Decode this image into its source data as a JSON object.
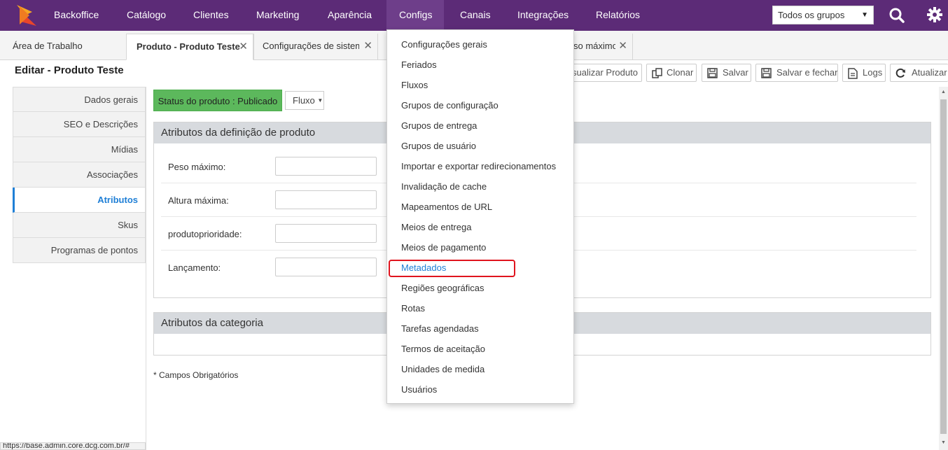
{
  "topnav": {
    "brand": "Backoffice",
    "items": [
      "Catálogo",
      "Clientes",
      "Marketing",
      "Aparência",
      "Configs",
      "Canais",
      "Integrações",
      "Relatórios"
    ],
    "group_select": "Todos os grupos",
    "icons": [
      "logo-icon",
      "search-icon",
      "gear-icon"
    ],
    "bg_color": "#5c2b77"
  },
  "tabs": [
    {
      "label": "Área de Trabalho",
      "closable": false
    },
    {
      "label": "Produto - Produto Teste",
      "closable": true,
      "active": true
    },
    {
      "label": "Configurações de sistema",
      "closable": true
    },
    {
      "label": "so máximo",
      "closable": true
    }
  ],
  "page": {
    "title": "Editar - Produto Teste",
    "buttons": [
      "sualizar Produto",
      "Clonar",
      "Salvar",
      "Salvar e fechar",
      "Logs",
      "Atualizar"
    ]
  },
  "sidebar": {
    "items": [
      "Dados gerais",
      "SEO e Descrições",
      "Mídias",
      "Associações",
      "Atributos",
      "Skus",
      "Programas de pontos"
    ],
    "active": "Atributos"
  },
  "content": {
    "status_button": "Status do produto : Publicado",
    "fluxo_button": "Fluxo",
    "panel1_title": "Atributos da definição de produto",
    "fields": [
      {
        "label": "Peso máximo:",
        "value": ""
      },
      {
        "label": "Altura máxima:",
        "value": ""
      },
      {
        "label": "produtoprioridade:",
        "value": ""
      },
      {
        "label": "Lançamento:",
        "value": ""
      }
    ],
    "panel2_title": "Atributos da categoria",
    "required_note": "* Campos Obrigatórios"
  },
  "dropdown": {
    "items": [
      "Configurações gerais",
      "Feriados",
      "Fluxos",
      "Grupos de configuração",
      "Grupos de entrega",
      "Grupos de usuário",
      "Importar e exportar redirecionamentos",
      "Invalidação de cache",
      "Mapeamentos de URL",
      "Meios de entrega",
      "Meios de pagamento",
      "Metadados",
      "Regiões geográficas",
      "Rotas",
      "Tarefas agendadas",
      "Termos de aceitação",
      "Unidades de medida",
      "Usuários"
    ],
    "highlighted": "Metadados"
  },
  "status_url": "https://base.admin.core.dcg.com.br/#"
}
